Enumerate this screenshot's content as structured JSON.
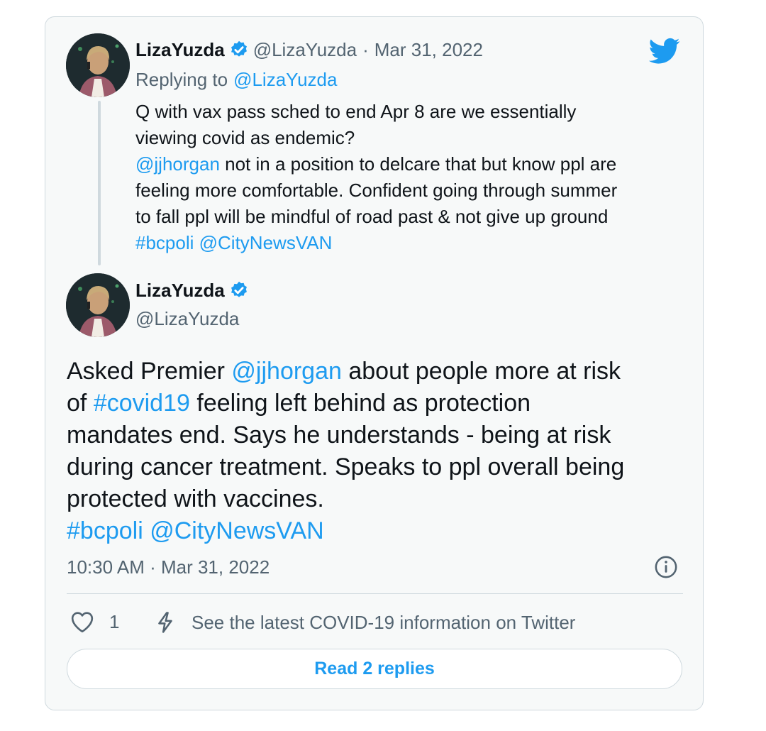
{
  "reply_tweet": {
    "display_name": "LizaYuzda",
    "handle": "@LizaYuzda",
    "separator": "·",
    "date": "Mar 31, 2022",
    "replying_to_prefix": "Replying to",
    "replying_to_handle": "@LizaYuzda",
    "text_lines": [
      {
        "plain": "Q with vax pass sched to end Apr 8 are we essentially"
      },
      {
        "plain": "viewing covid as endemic?"
      },
      {
        "mention": "@jjhorgan",
        "plain": " not in a position to delcare that but know ppl are"
      },
      {
        "plain": "feeling more comfortable. Confident going through summer"
      },
      {
        "plain": "to fall ppl will be mindful of road past & not give up ground"
      },
      {
        "tag": "#bcpoli",
        "space": " ",
        "mention": "@CityNewsVAN"
      }
    ]
  },
  "main_tweet": {
    "display_name": "LizaYuzda",
    "handle": "@LizaYuzda",
    "text_lines": [
      {
        "a": "Asked Premier ",
        "b": "@jjhorgan",
        "c": " about people more at risk"
      },
      {
        "a": "of ",
        "b": "#covid19",
        "c": " feeling left behind as protection"
      },
      {
        "a": "mandates end. Says he understands - being at risk"
      },
      {
        "a": "during cancer treatment. Speaks to ppl overall being"
      },
      {
        "a": "protected with vaccines."
      },
      {
        "b": "#bcpoli",
        "c": " ",
        "d": "@CityNewsVAN"
      }
    ],
    "timestamp": "10:30 AM · Mar 31, 2022",
    "like_count": "1",
    "covid_info_link": "See the latest COVID-19 information on Twitter",
    "read_replies_label": "Read 2 replies"
  },
  "icons": {
    "brand": "twitter-bird-icon",
    "verified": "verified-badge-icon",
    "info": "info-icon",
    "like": "heart-icon",
    "covid": "lightning-bolt-icon"
  },
  "colors": {
    "accent": "#1d9bf0",
    "text": "#0f1419",
    "muted": "#536471",
    "card_background": "#f7f9f9",
    "border": "#cfd9de"
  }
}
